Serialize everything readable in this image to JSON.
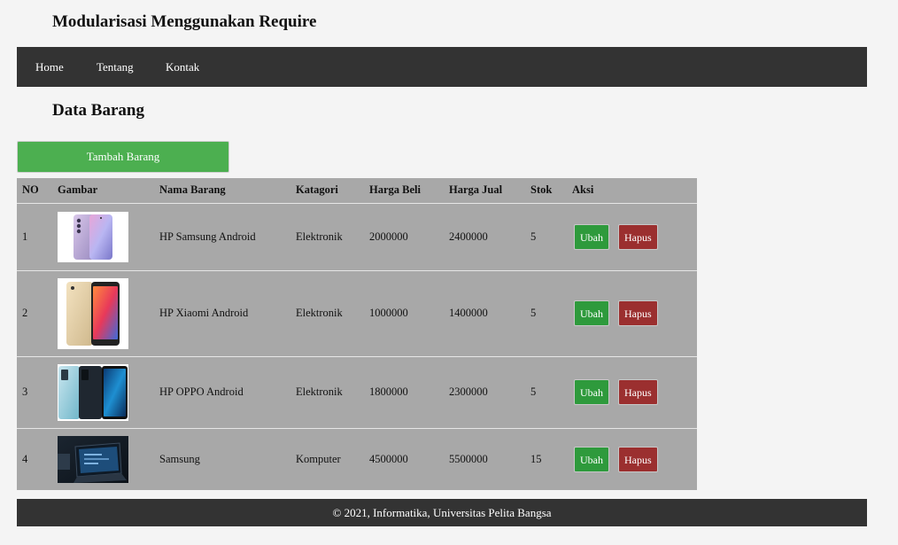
{
  "header": {
    "title": "Modularisasi Menggunakan Require"
  },
  "nav": {
    "items": [
      {
        "label": "Home"
      },
      {
        "label": "Tentang"
      },
      {
        "label": "Kontak"
      }
    ]
  },
  "main": {
    "heading": "Data Barang",
    "add_button": "Tambah Barang",
    "table": {
      "headers": [
        "NO",
        "Gambar",
        "Nama Barang",
        "Katagori",
        "Harga Beli",
        "Harga Jual",
        "Stok",
        "Aksi"
      ],
      "rows": [
        {
          "no": "1",
          "image": "samsung-phone-image",
          "name": "HP Samsung Android",
          "category": "Elektronik",
          "buy": "2000000",
          "sell": "2400000",
          "stock": "5",
          "edit": "Ubah",
          "delete": "Hapus"
        },
        {
          "no": "2",
          "image": "xiaomi-phone-image",
          "name": "HP Xiaomi Android",
          "category": "Elektronik",
          "buy": "1000000",
          "sell": "1400000",
          "stock": "5",
          "edit": "Ubah",
          "delete": "Hapus"
        },
        {
          "no": "3",
          "image": "oppo-phone-image",
          "name": "HP OPPO Android",
          "category": "Elektronik",
          "buy": "1800000",
          "sell": "2300000",
          "stock": "5",
          "edit": "Ubah",
          "delete": "Hapus"
        },
        {
          "no": "4",
          "image": "samsung-laptop-image",
          "name": "Samsung",
          "category": "Komputer",
          "buy": "4500000",
          "sell": "5500000",
          "stock": "15",
          "edit": "Ubah",
          "delete": "Hapus"
        }
      ]
    }
  },
  "footer": {
    "text": "© 2021, Informatika, Universitas Pelita Bangsa"
  },
  "colors": {
    "nav_bg": "#333333",
    "add_button": "#4caf50",
    "edit_button": "#2e9a3c",
    "delete_button": "#9b2f2f",
    "table_bg": "#a8a8a8"
  }
}
